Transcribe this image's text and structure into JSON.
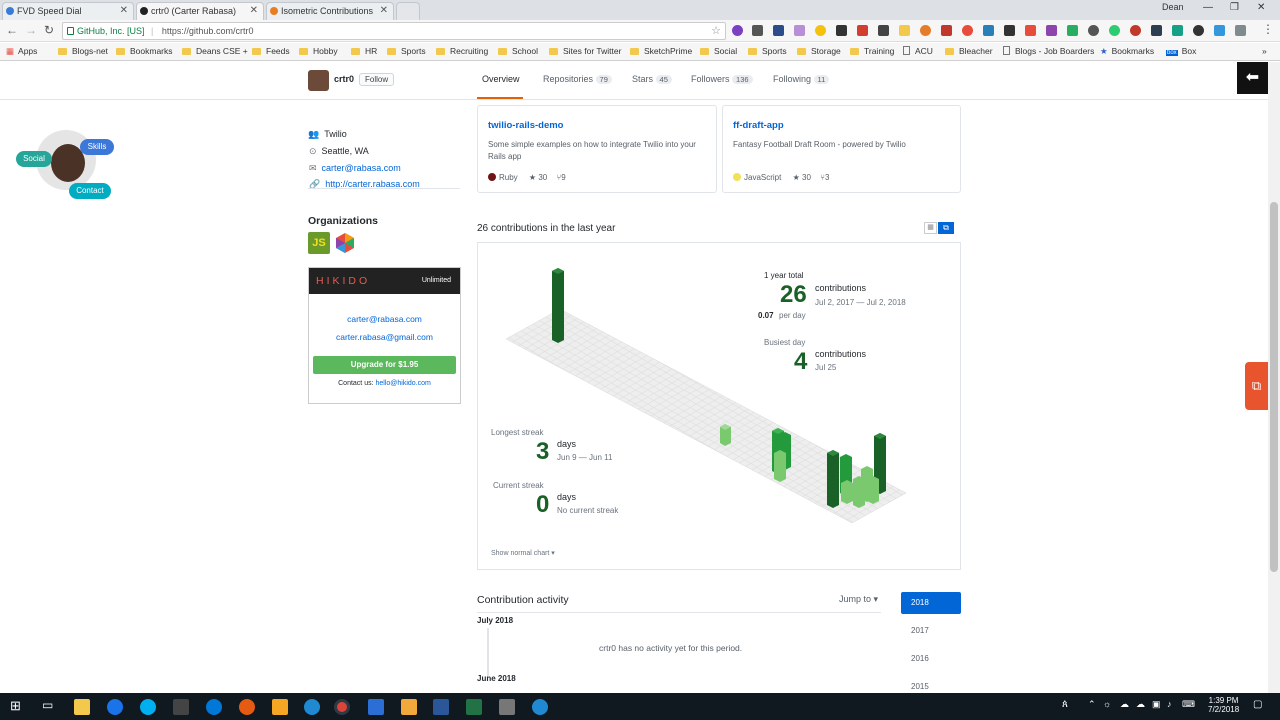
{
  "browser": {
    "tabs": [
      {
        "title": "FVD Speed Dial"
      },
      {
        "title": "crtr0 (Carter Rabasa)"
      },
      {
        "title": "Isometric Contributions"
      }
    ],
    "user_badge": "Dean",
    "secure_label": "GitHub, Inc. [US]",
    "url": "https://github.com/crtr0",
    "bookmarks": [
      "Apps",
      "Blogs-net",
      "Bookmarks",
      "Deans CSE +",
      "Feeds",
      "Hobby",
      "HR",
      "Sports",
      "Recruiting",
      "School",
      "Sites for Twitter",
      "SketchPrime",
      "Social",
      "Sports",
      "Storage",
      "Training",
      "ACU",
      "Bleacher",
      "Blogs - Job Boarders",
      "Bookmarks",
      "Box"
    ]
  },
  "widget": {
    "social": "Social",
    "skills": "Skills",
    "contact": "Contact"
  },
  "profile": {
    "username": "crtr0",
    "follow": "Follow",
    "company": "Twilio",
    "location": "Seattle, WA",
    "email": "carter@rabasa.com",
    "website": "http://carter.rabasa.com",
    "organizations_title": "Organizations",
    "org_js": "JS"
  },
  "nav": {
    "overview": "Overview",
    "repositories": "Repositories",
    "repositories_count": "79",
    "stars": "Stars",
    "stars_count": "45",
    "followers": "Followers",
    "followers_count": "136",
    "following": "Following",
    "following_count": "11"
  },
  "pins": [
    {
      "name": "twilio-rails-demo",
      "description": "Some simple examples on how to integrate Twilio into your Rails app",
      "language": "Ruby",
      "language_color": "#701516",
      "stars": "30",
      "forks": "9"
    },
    {
      "name": "ff-draft-app",
      "description": "Fantasy Football Draft Room - powered by Twilio",
      "language": "JavaScript",
      "language_color": "#f1e05a",
      "stars": "30",
      "forks": "3"
    }
  ],
  "hikido": {
    "brand": "HIKIDO",
    "plan": "Unlimited",
    "email1": "carter@rabasa.com",
    "email2": "carter.rabasa@gmail.com",
    "upgrade": "Upgrade for $1.95",
    "contact_prefix": "Contact us:",
    "contact_email": "hello@hikido.com"
  },
  "contrib": {
    "heading": "26 contributions in the last year",
    "total_label": "1 year total",
    "total": "26",
    "total_unit": "contributions",
    "total_range": "Jul 2, 2017 — Jul 2, 2018",
    "per_day": "0.07",
    "per_day_unit": "per day",
    "busiest_label": "Busiest day",
    "busiest": "4",
    "busiest_unit": "contributions",
    "busiest_date": "Jul 25",
    "longest_label": "Longest streak",
    "longest": "3",
    "longest_unit": "days",
    "longest_range": "Jun 9 — Jun 11",
    "current_label": "Current streak",
    "current": "0",
    "current_unit": "days",
    "current_range": "No current streak",
    "show_normal": "Show normal chart"
  },
  "activity": {
    "title": "Contribution activity",
    "jump_to": "Jump to",
    "month1": "July 2018",
    "empty": "crtr0 has no activity yet for this period.",
    "month2": "June 2018",
    "years": [
      "2018",
      "2017",
      "2016",
      "2015"
    ]
  },
  "taskbar": {
    "time": "1:39 PM",
    "date": "7/2/2018",
    "notifications": "5"
  },
  "colors": {
    "accent": "#0366d6",
    "green_dark": "#196127",
    "green_mid": "#239a3b",
    "green_light": "#7bc96f",
    "upgrade": "#5cb85c"
  }
}
